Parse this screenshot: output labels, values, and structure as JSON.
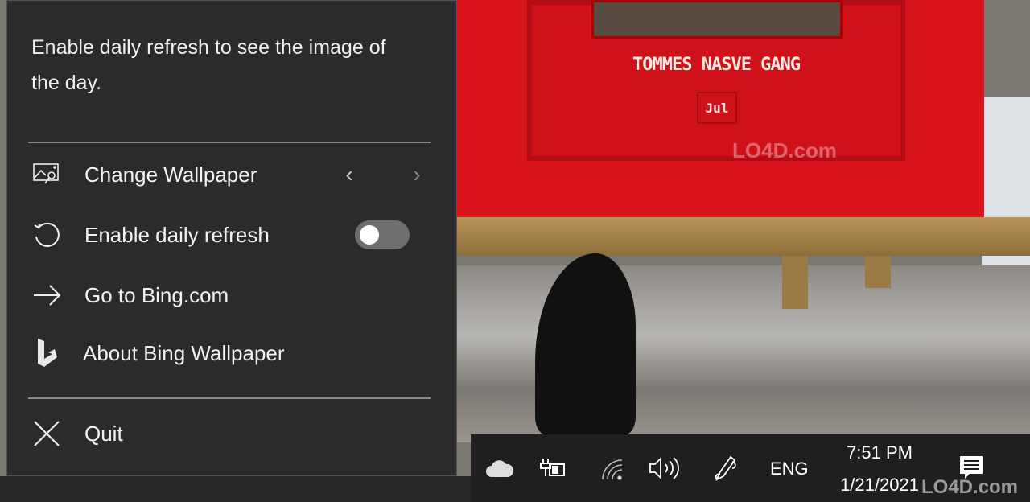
{
  "menu": {
    "description": "Enable daily refresh to see the image of the day.",
    "items": [
      {
        "label": "Change Wallpaper",
        "icon": "image-search-icon"
      },
      {
        "label": "Enable daily refresh",
        "icon": "refresh-icon",
        "toggle_on": false
      },
      {
        "label": "Go to Bing.com",
        "icon": "arrow-right-icon"
      },
      {
        "label": "About Bing Wallpaper",
        "icon": "bing-logo-icon"
      },
      {
        "label": "Quit",
        "icon": "close-icon"
      }
    ]
  },
  "wallpaper": {
    "hut_text": "TOMMES NASVE GANG",
    "sign": "Jul"
  },
  "taskbar": {
    "language": "ENG",
    "time": "7:51 PM",
    "date": "1/21/2021",
    "icons": [
      "onedrive-icon",
      "battery-charging-icon",
      "wifi-icon",
      "volume-icon",
      "pen-icon",
      "action-center-icon"
    ]
  },
  "watermark": "LO4D.com"
}
